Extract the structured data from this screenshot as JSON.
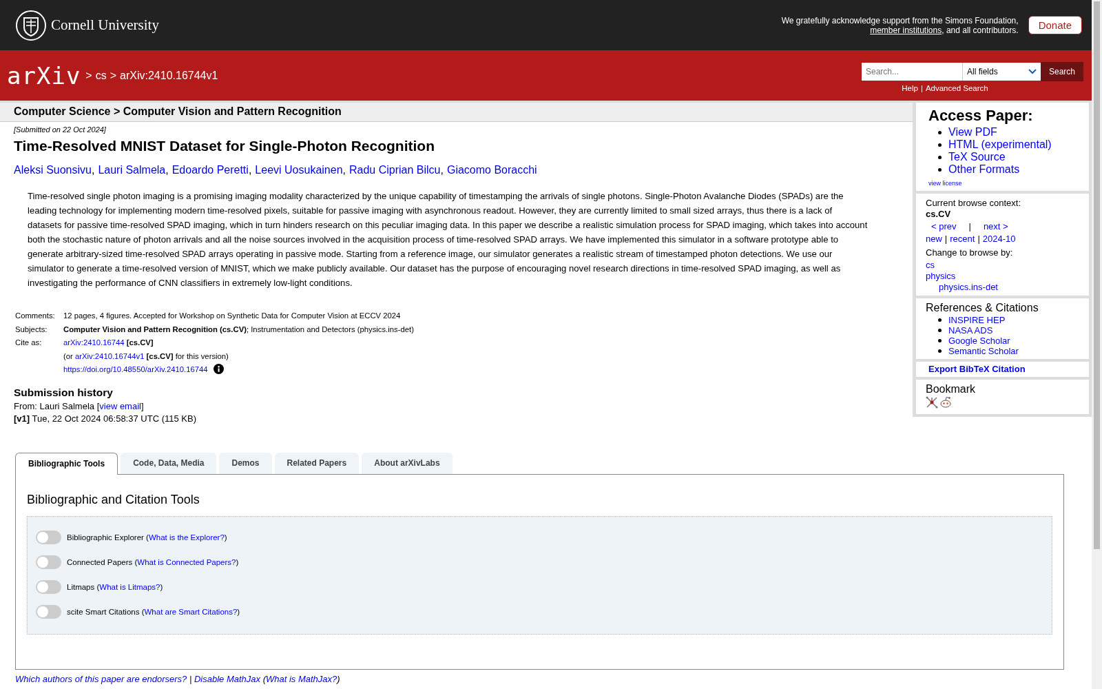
{
  "header": {
    "institution": "Cornell University",
    "support_text": "We gratefully acknowledge support from the Simons Foundation,",
    "support_link": "member institutions",
    "support_tail": ", and all contributors.",
    "donate": "Donate"
  },
  "nav": {
    "logo": "arXiv",
    "crumbs": [
      {
        "sep": ">",
        "text": "cs"
      },
      {
        "sep": ">",
        "text": "arXiv:2410.16744v1"
      }
    ],
    "search": {
      "placeholder": "Search...",
      "field_select": "All fields",
      "button": "Search"
    },
    "help_links": [
      {
        "text": "Help",
        "sep": "|"
      },
      {
        "text": "Advanced Search"
      }
    ]
  },
  "subheader": "Computer Science > Computer Vision and Pattern Recognition",
  "submitted": "[Submitted on 22 Oct 2024]",
  "title": "Time-Resolved MNIST Dataset for Single-Photon Recognition",
  "authors": [
    {
      "name": "Aleksi Suonsivu",
      "sep": ","
    },
    {
      "name": "Lauri Salmela",
      "sep": ","
    },
    {
      "name": "Edoardo Peretti",
      "sep": ","
    },
    {
      "name": "Leevi Uosukainen",
      "sep": ","
    },
    {
      "name": "Radu Ciprian Bilcu",
      "sep": ","
    },
    {
      "name": "Giacomo Boracchi"
    }
  ],
  "abstract": "Time-resolved single photon imaging is a promising imaging modality characterized by the unique capability of timestamping the arrivals of single photons. Single-Photon Avalanche Diodes (SPADs) are the leading technology for implementing modern time-resolved pixels, suitable for passive imaging with asynchronous readout. However, they are currently limited to small sized arrays, thus there is a lack of datasets for passive time-resolved SPAD imaging, which in turn hinders research on this peculiar imaging data. In this paper we describe a realistic simulation process for SPAD imaging, which takes into account both the stochastic nature of photon arrivals and all the noise sources involved in the acquisition process of time-resolved SPAD arrays. We have implemented this simulator in a software prototype able to generate arbitrary-sized time-resolved SPAD arrays operating in passive mode. Starting from a reference image, our simulator generates a realistic stream of timestamped photon detections. We use our simulator to generate a time-resolved version of MNIST, which we make publicly available. Our dataset has the purpose of encouraging novel research directions in time-resolved SPAD imaging, as well as investigating the performance of CNN classifiers in extremely low-light conditions.",
  "metadata": [
    {
      "label": "Comments:",
      "lines": [
        [
          {
            "text": "12 pages, 4 figures. Accepted for Workshop on Synthetic Data for Computer Vision at ECCV 2024",
            "kind": "text"
          }
        ]
      ]
    },
    {
      "label": "Subjects:",
      "lines": [
        [
          {
            "text": "**Computer Vision and Pattern Recognition (cs.CV)**; Instrumentation and Detectors (physics.ins-det)",
            "kind": "text"
          }
        ]
      ]
    },
    {
      "label": "Cite as:",
      "lines": [
        [
          {
            "text": "arXiv:2410.16744",
            "kind": "link"
          },
          {
            "text": " **[cs.CV]**",
            "kind": "text"
          }
        ],
        [
          {
            "text": "(or ",
            "kind": "text"
          },
          {
            "text": "arXiv:2410.16744v1",
            "kind": "link"
          },
          {
            "text": " **[cs.CV]** for this version)",
            "kind": "text"
          }
        ],
        [
          {
            "text": "https://doi.org/10.48550/arXiv.2410.16744",
            "kind": "link"
          },
          {
            "kind": "info"
          }
        ]
      ]
    }
  ],
  "history": {
    "heading": "Submission history",
    "from_label": "From: Lauri Salmela [",
    "from_link": "view email",
    "from_tail": "]",
    "versions": [
      {
        "version": "[v1]",
        "text": "Tue, 22 Oct 2024 06:58:37 UTC (115 KB)"
      }
    ]
  },
  "tabs": [
    {
      "label": "Bibliographic Tools",
      "selected": true
    },
    {
      "label": "Code, Data, Media",
      "selected": false
    },
    {
      "label": "Demos",
      "selected": false
    },
    {
      "label": "Related Papers",
      "selected": false
    },
    {
      "label": "About arXivLabs",
      "selected": false
    }
  ],
  "tools": {
    "heading": "Bibliographic and Citation Tools",
    "items": [
      {
        "name": "Bibliographic Explorer (",
        "help": "What is the Explorer?",
        "tail": ")",
        "on": false
      },
      {
        "name": "Connected Papers (",
        "help": "What is Connected Papers?",
        "tail": ")",
        "on": false
      },
      {
        "name": "Litmaps (",
        "help": "What is Litmaps?",
        "tail": ")",
        "on": false
      },
      {
        "name": "scite Smart Citations (",
        "help": "What are Smart Citations?",
        "tail": ")",
        "on": false
      }
    ]
  },
  "footer_links": [
    {
      "text": "Which authors of this paper are endorsers?",
      "sep": " | "
    },
    {
      "text": "Disable MathJax",
      "sep": " ("
    },
    {
      "text": "What is MathJax?",
      "sep": ")"
    }
  ],
  "sidebar": {
    "access": {
      "heading": "Access Paper:",
      "links": [
        "View PDF",
        "HTML (experimental)",
        "TeX Source",
        "Other Formats"
      ],
      "license": "view license"
    },
    "browse": {
      "label": "Current browse context:",
      "context": "cs.CV",
      "prev": "< prev",
      "divider": "|",
      "next": "next >",
      "links": [
        {
          "text": "new",
          "kind": "link"
        },
        {
          "text": "|",
          "kind": "separator"
        },
        {
          "text": "recent",
          "kind": "link"
        },
        {
          "text": "|",
          "kind": "separator"
        },
        {
          "text": "2024-10",
          "kind": "link"
        }
      ],
      "change_label": "Change to browse by:",
      "categories": [
        {
          "text": "cs"
        },
        {
          "text": "physics",
          "children": [
            {
              "text": "physics.ins-det"
            }
          ]
        }
      ]
    },
    "refs": {
      "heading": "References & Citations",
      "links": [
        "INSPIRE HEP",
        "NASA ADS",
        "Google Scholar",
        "Semantic Scholar"
      ]
    },
    "export": "Export BibTeX Citation",
    "bookmark": {
      "heading": "Bookmark"
    }
  }
}
